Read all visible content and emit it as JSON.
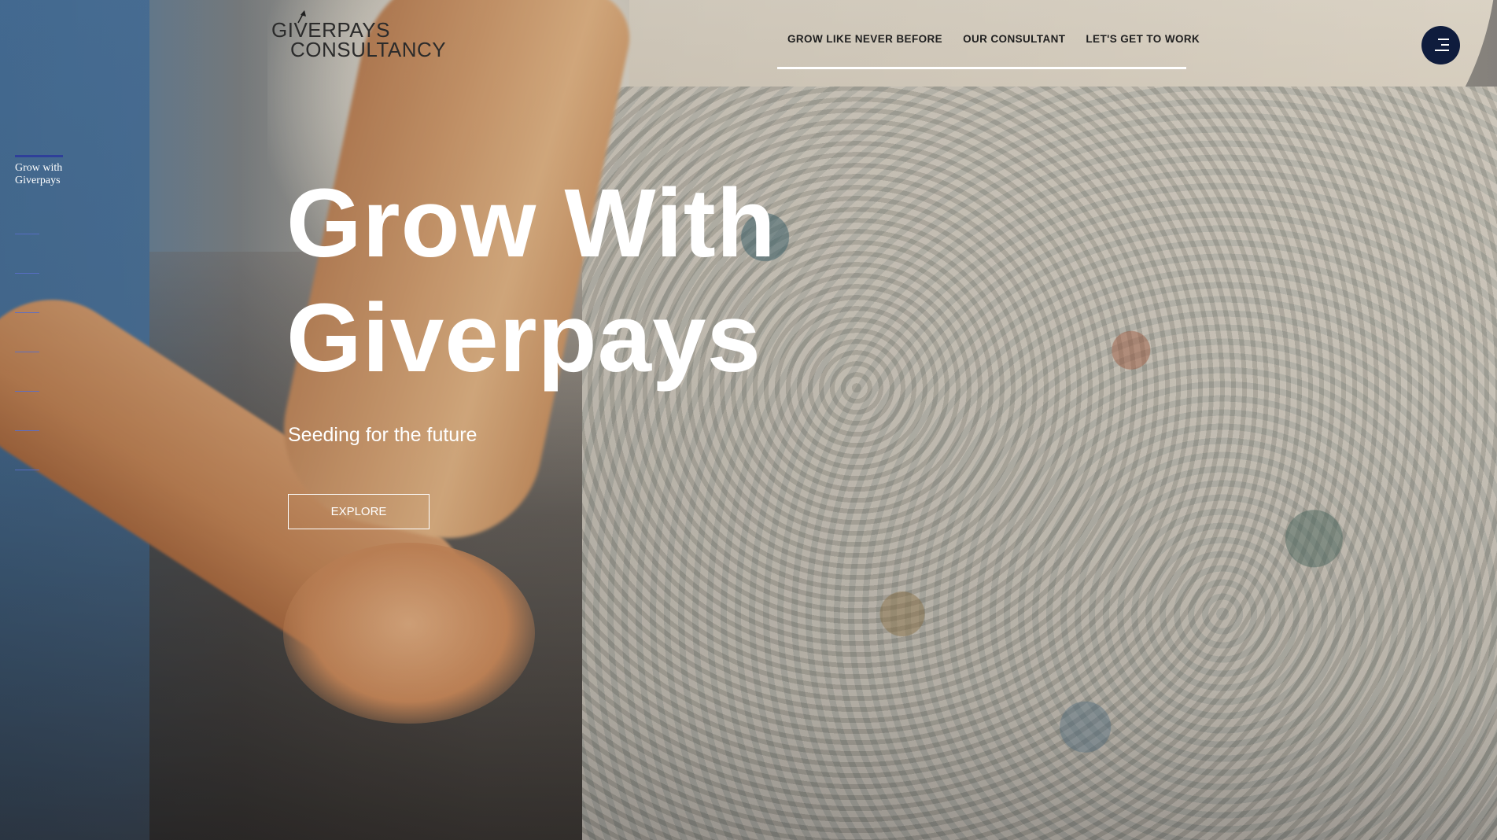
{
  "logo": {
    "line1": "GIVERPAYS",
    "line2": "CONSULTANCY"
  },
  "nav": {
    "items": [
      {
        "label": "GROW LIKE NEVER BEFORE"
      },
      {
        "label": "OUR CONSULTANT"
      },
      {
        "label": "LET'S GET TO WORK"
      }
    ]
  },
  "menu": {
    "icon": "hamburger-menu-icon"
  },
  "side_pager": {
    "active_label": "Grow with Giverpays"
  },
  "hero": {
    "title": "Grow With Giverpays",
    "subtitle": "Seeding for the future",
    "cta_label": "EXPLORE"
  },
  "colors": {
    "menu_button_bg": "#0f1c3d",
    "pager_accent": "#2f3f9a",
    "text_light": "#ffffff",
    "text_dark": "#1f1f1f"
  }
}
